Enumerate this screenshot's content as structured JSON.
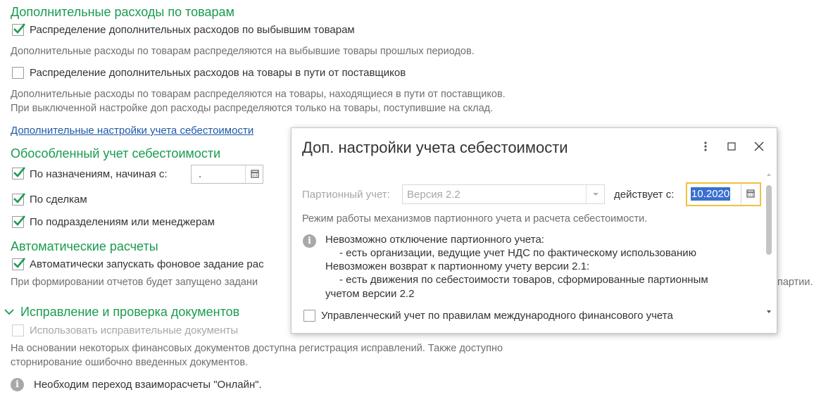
{
  "colors": {
    "section": "#1a9b4f",
    "link": "#1f5aa8",
    "focus": "#f0c040",
    "selection": "#3a6fd0"
  },
  "sections": {
    "extra_costs": {
      "title": "Дополнительные расходы по товарам",
      "opt1_label": "Распределение дополнительных расходов по выбывшим товарам",
      "opt1_checked": true,
      "opt1_note": "Дополнительные расходы по товарам распределяются на выбывшие товары прошлых периодов.",
      "opt2_label": "Распределение дополнительных расходов на товары в пути от поставщиков",
      "opt2_checked": false,
      "opt2_note_line1": "Дополнительные расходы по товарам распределяются на товары, находящиеся в пути от поставщиков.",
      "opt2_note_line2": "При выключенной настройке доп расходы распределяются только на товары, поступившие на склад.",
      "link": "Дополнительные настройки учета себестоимости"
    },
    "separate": {
      "title": "Обособленный учет себестоимости",
      "by_purpose_label": "По назначениям, начиная с:",
      "by_purpose_date": " .",
      "by_deals_label": "По сделкам",
      "by_departments_label": "По подразделениям или менеджерам"
    },
    "auto": {
      "title": "Автоматические расчеты",
      "opt_label": "Автоматически запускать фоновое задание рас",
      "note": "При формировании отчетов будет запущено задани",
      "note_tail": "партии."
    },
    "corrections": {
      "title": "Исправление и проверка документов",
      "opt_label": "Использовать исправительные документы",
      "note_line1": "На основании некоторых финансовых документов доступна регистрация исправлений. Также доступно",
      "note_line2": "сторнирование ошибочно введенных документов.",
      "info": "Необходим переход взаиморасчеты \"Онлайн\"."
    }
  },
  "dialog": {
    "title": "Доп. настройки учета себестоимости",
    "menu_icon": "more-vertical-icon",
    "maximize_icon": "maximize-icon",
    "close_icon": "close-icon",
    "batch_label": "Партионный учет:",
    "batch_value": "Версия 2.2",
    "effective_label": "действует с:",
    "effective_date": "10.2020",
    "mode_note": "Режим работы механизмов партионного учета и расчета себестоимости.",
    "info_line1": "Невозможно отключение партионного учета:",
    "info_line2": "- есть организации, ведущие учет НДС по фактическому использованию",
    "info_line3": "Невозможен возврат к партионному учету версии 2.1:",
    "info_line4": "- есть движения по себестоимости товаров, сформированные партионным",
    "info_line5": "учетом версии 2.2",
    "ifrs_label": "Управленческий учет по правилам международного финансового учета"
  }
}
